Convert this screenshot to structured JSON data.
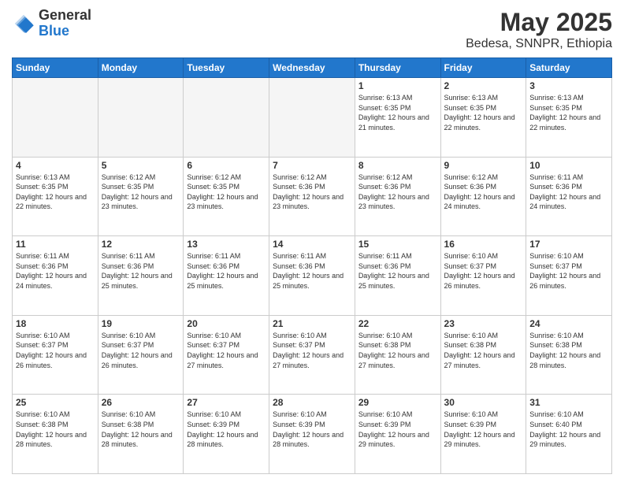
{
  "logo": {
    "general": "General",
    "blue": "Blue"
  },
  "title": "May 2025",
  "subtitle": "Bedesa, SNNPR, Ethiopia",
  "days_of_week": [
    "Sunday",
    "Monday",
    "Tuesday",
    "Wednesday",
    "Thursday",
    "Friday",
    "Saturday"
  ],
  "weeks": [
    [
      {
        "day": "",
        "info": ""
      },
      {
        "day": "",
        "info": ""
      },
      {
        "day": "",
        "info": ""
      },
      {
        "day": "",
        "info": ""
      },
      {
        "day": "1",
        "info": "Sunrise: 6:13 AM\nSunset: 6:35 PM\nDaylight: 12 hours and 21 minutes."
      },
      {
        "day": "2",
        "info": "Sunrise: 6:13 AM\nSunset: 6:35 PM\nDaylight: 12 hours and 22 minutes."
      },
      {
        "day": "3",
        "info": "Sunrise: 6:13 AM\nSunset: 6:35 PM\nDaylight: 12 hours and 22 minutes."
      }
    ],
    [
      {
        "day": "4",
        "info": "Sunrise: 6:13 AM\nSunset: 6:35 PM\nDaylight: 12 hours and 22 minutes."
      },
      {
        "day": "5",
        "info": "Sunrise: 6:12 AM\nSunset: 6:35 PM\nDaylight: 12 hours and 23 minutes."
      },
      {
        "day": "6",
        "info": "Sunrise: 6:12 AM\nSunset: 6:35 PM\nDaylight: 12 hours and 23 minutes."
      },
      {
        "day": "7",
        "info": "Sunrise: 6:12 AM\nSunset: 6:36 PM\nDaylight: 12 hours and 23 minutes."
      },
      {
        "day": "8",
        "info": "Sunrise: 6:12 AM\nSunset: 6:36 PM\nDaylight: 12 hours and 23 minutes."
      },
      {
        "day": "9",
        "info": "Sunrise: 6:12 AM\nSunset: 6:36 PM\nDaylight: 12 hours and 24 minutes."
      },
      {
        "day": "10",
        "info": "Sunrise: 6:11 AM\nSunset: 6:36 PM\nDaylight: 12 hours and 24 minutes."
      }
    ],
    [
      {
        "day": "11",
        "info": "Sunrise: 6:11 AM\nSunset: 6:36 PM\nDaylight: 12 hours and 24 minutes."
      },
      {
        "day": "12",
        "info": "Sunrise: 6:11 AM\nSunset: 6:36 PM\nDaylight: 12 hours and 25 minutes."
      },
      {
        "day": "13",
        "info": "Sunrise: 6:11 AM\nSunset: 6:36 PM\nDaylight: 12 hours and 25 minutes."
      },
      {
        "day": "14",
        "info": "Sunrise: 6:11 AM\nSunset: 6:36 PM\nDaylight: 12 hours and 25 minutes."
      },
      {
        "day": "15",
        "info": "Sunrise: 6:11 AM\nSunset: 6:36 PM\nDaylight: 12 hours and 25 minutes."
      },
      {
        "day": "16",
        "info": "Sunrise: 6:10 AM\nSunset: 6:37 PM\nDaylight: 12 hours and 26 minutes."
      },
      {
        "day": "17",
        "info": "Sunrise: 6:10 AM\nSunset: 6:37 PM\nDaylight: 12 hours and 26 minutes."
      }
    ],
    [
      {
        "day": "18",
        "info": "Sunrise: 6:10 AM\nSunset: 6:37 PM\nDaylight: 12 hours and 26 minutes."
      },
      {
        "day": "19",
        "info": "Sunrise: 6:10 AM\nSunset: 6:37 PM\nDaylight: 12 hours and 26 minutes."
      },
      {
        "day": "20",
        "info": "Sunrise: 6:10 AM\nSunset: 6:37 PM\nDaylight: 12 hours and 27 minutes."
      },
      {
        "day": "21",
        "info": "Sunrise: 6:10 AM\nSunset: 6:37 PM\nDaylight: 12 hours and 27 minutes."
      },
      {
        "day": "22",
        "info": "Sunrise: 6:10 AM\nSunset: 6:38 PM\nDaylight: 12 hours and 27 minutes."
      },
      {
        "day": "23",
        "info": "Sunrise: 6:10 AM\nSunset: 6:38 PM\nDaylight: 12 hours and 27 minutes."
      },
      {
        "day": "24",
        "info": "Sunrise: 6:10 AM\nSunset: 6:38 PM\nDaylight: 12 hours and 28 minutes."
      }
    ],
    [
      {
        "day": "25",
        "info": "Sunrise: 6:10 AM\nSunset: 6:38 PM\nDaylight: 12 hours and 28 minutes."
      },
      {
        "day": "26",
        "info": "Sunrise: 6:10 AM\nSunset: 6:38 PM\nDaylight: 12 hours and 28 minutes."
      },
      {
        "day": "27",
        "info": "Sunrise: 6:10 AM\nSunset: 6:39 PM\nDaylight: 12 hours and 28 minutes."
      },
      {
        "day": "28",
        "info": "Sunrise: 6:10 AM\nSunset: 6:39 PM\nDaylight: 12 hours and 28 minutes."
      },
      {
        "day": "29",
        "info": "Sunrise: 6:10 AM\nSunset: 6:39 PM\nDaylight: 12 hours and 29 minutes."
      },
      {
        "day": "30",
        "info": "Sunrise: 6:10 AM\nSunset: 6:39 PM\nDaylight: 12 hours and 29 minutes."
      },
      {
        "day": "31",
        "info": "Sunrise: 6:10 AM\nSunset: 6:40 PM\nDaylight: 12 hours and 29 minutes."
      }
    ]
  ]
}
